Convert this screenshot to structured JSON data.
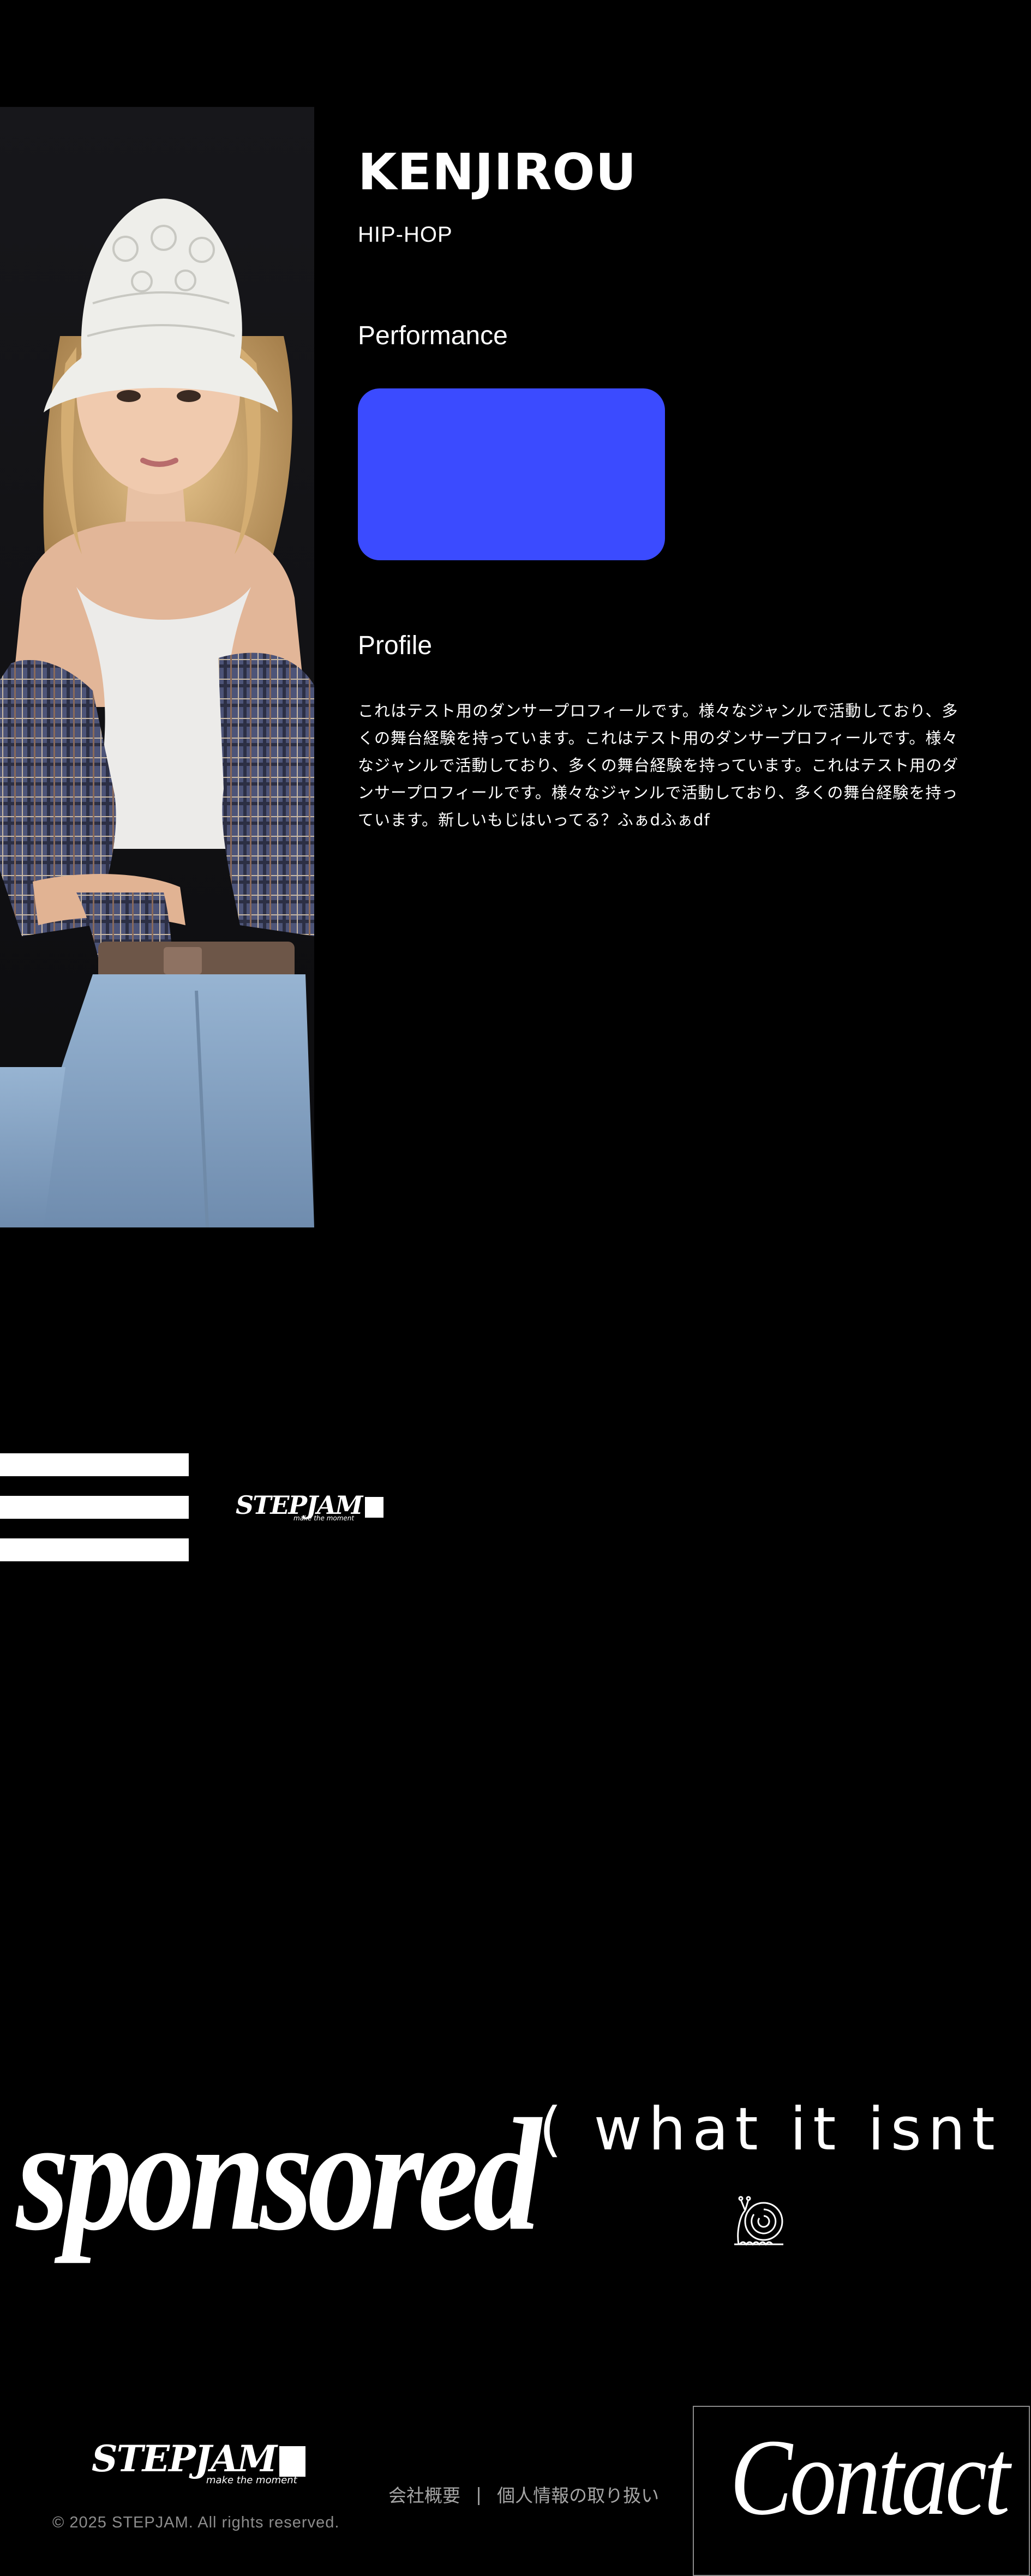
{
  "dancer": {
    "name": "KENJIROU",
    "genre": "HIP-HOP",
    "photo_alt": "dancer photo"
  },
  "performance": {
    "heading": "Performance",
    "video_color": "#3b4bff"
  },
  "profile": {
    "heading": "Profile",
    "text": "これはテスト用のダンサープロフィールです。様々なジャンルで活動しており、多くの舞台経験を持っています。これはテスト用のダンサープロフィールです。様々なジャンルで活動しており、多くの舞台経験を持っています。これはテスト用のダンサープロフィールです。様々なジャンルで活動しており、多くの舞台経験を持っています。新しいもじはいってる？ふぁdふぁdf"
  },
  "header": {
    "menu_icon": "hamburger-icon",
    "logo_text": "STEPJAM",
    "logo_tagline": "make the moment"
  },
  "sponsored": {
    "title": "sponsored",
    "subtitle": "( what it isnt )",
    "icon": "snail-icon"
  },
  "footer": {
    "logo_text": "STEPJAM",
    "logo_tagline": "make the moment",
    "copyright": "© 2025 STEPJAM. All rights reserved.",
    "links": [
      "会社概要",
      "個人情報の取り扱い"
    ],
    "separator": "|",
    "contact_label": "Contact"
  },
  "colors": {
    "background": "#000000",
    "accent": "#3b4bff",
    "text": "#ffffff",
    "muted": "#a5a5a5"
  }
}
